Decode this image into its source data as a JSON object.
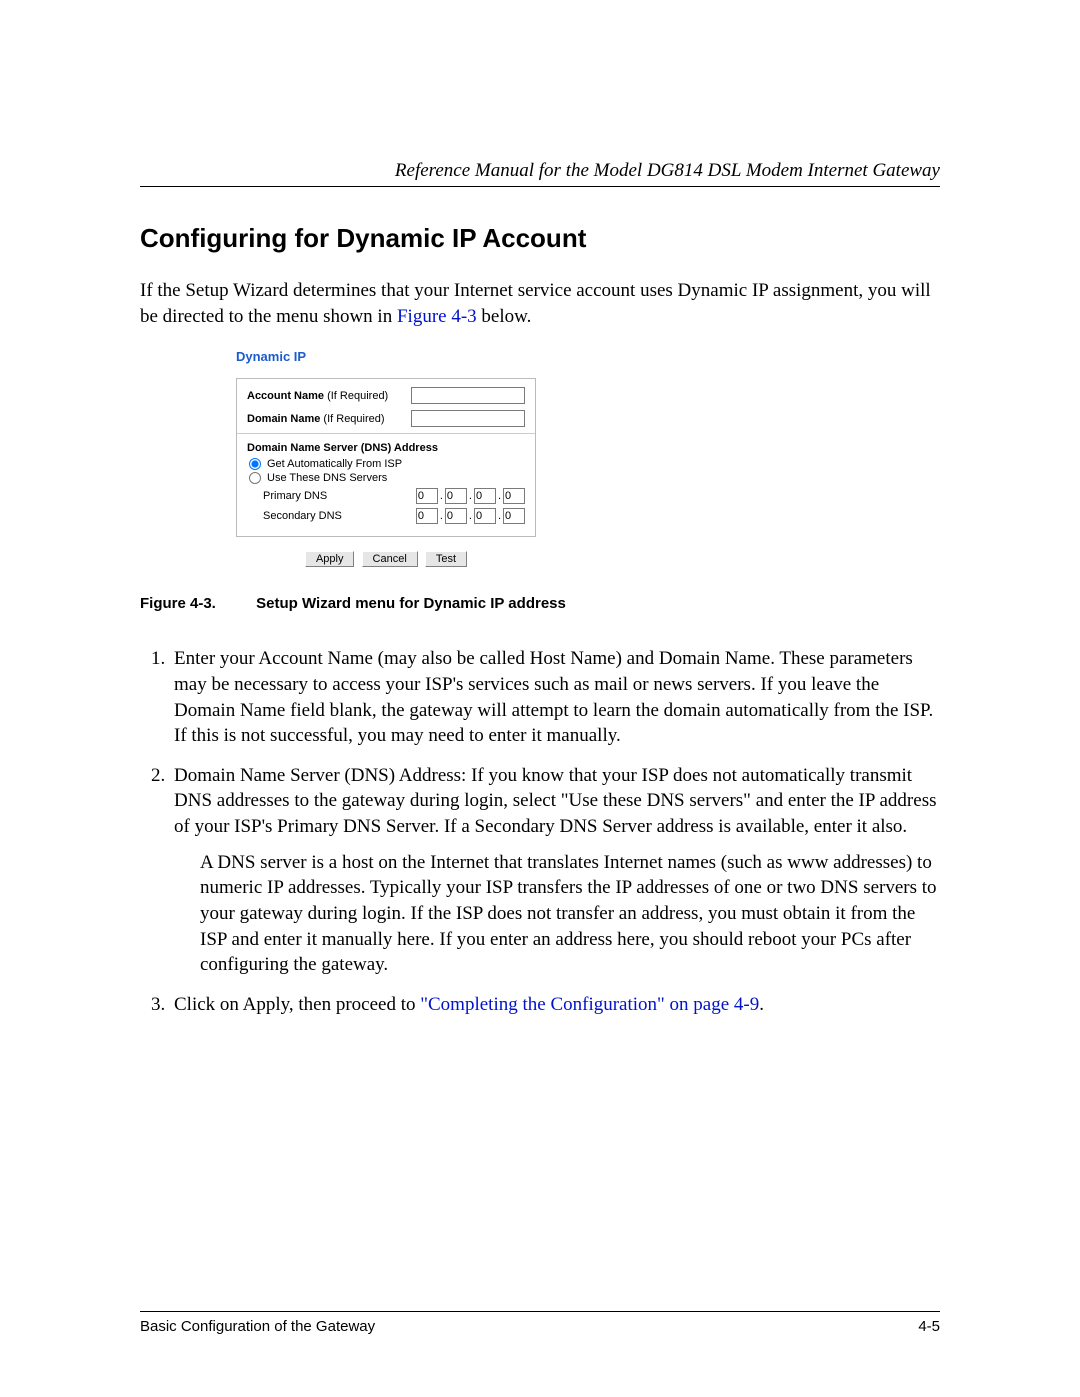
{
  "header": {
    "title": "Reference Manual for the Model DG814 DSL Modem Internet Gateway"
  },
  "section_heading": "Configuring for Dynamic IP Account",
  "intro": {
    "part1": "If the Setup Wizard determines that your Internet service account uses Dynamic IP assignment, you will be directed to the menu shown in ",
    "figref": "Figure 4-3",
    "part2": " below."
  },
  "figure": {
    "title": "Dynamic IP",
    "account_label_bold": "Account Name",
    "account_label_plain": " (If Required)",
    "domain_label_bold": "Domain Name",
    "domain_label_plain": " (If Required)",
    "account_value": "",
    "domain_value": "",
    "dns_heading": "Domain Name Server (DNS) Address",
    "radio_auto": "Get Automatically From ISP",
    "radio_custom": "Use These DNS Servers",
    "primary_label": "Primary DNS",
    "secondary_label": "Secondary DNS",
    "primary_octets": [
      "0",
      "0",
      "0",
      "0"
    ],
    "secondary_octets": [
      "0",
      "0",
      "0",
      "0"
    ],
    "buttons": {
      "apply": "Apply",
      "cancel": "Cancel",
      "test": "Test"
    },
    "caption_no": "Figure 4-3.",
    "caption_text": "Setup Wizard menu for Dynamic IP address"
  },
  "steps": {
    "s1": "Enter your Account Name (may also be called Host Name) and Domain Name. These parameters may be necessary to access your ISP's services such as mail or news servers. If you leave the Domain Name field blank, the gateway will attempt to learn the domain automatically from the ISP. If this is not successful, you may need to enter it manually.",
    "s2": "Domain Name Server (DNS) Address: If you know that your ISP does not automatically transmit DNS addresses to the gateway during login, select \"Use these DNS servers\" and enter the IP address of your ISP's Primary DNS Server. If a Secondary DNS Server address is available, enter it also.",
    "s2_note": "A DNS server is a host on the Internet that translates Internet names (such as www addresses) to numeric IP addresses. Typically your ISP transfers the IP addresses of one or two DNS servers to your gateway during login. If the ISP does not transfer an address, you must obtain it from the ISP and enter it manually here. If you enter an address here, you should reboot your PCs after configuring the gateway.",
    "s3_part1": "Click on Apply, then proceed to ",
    "s3_link": "\"Completing the Configuration\" on page 4-9",
    "s3_part2": "."
  },
  "footer": {
    "left": "Basic Configuration of the Gateway",
    "right": "4-5"
  }
}
